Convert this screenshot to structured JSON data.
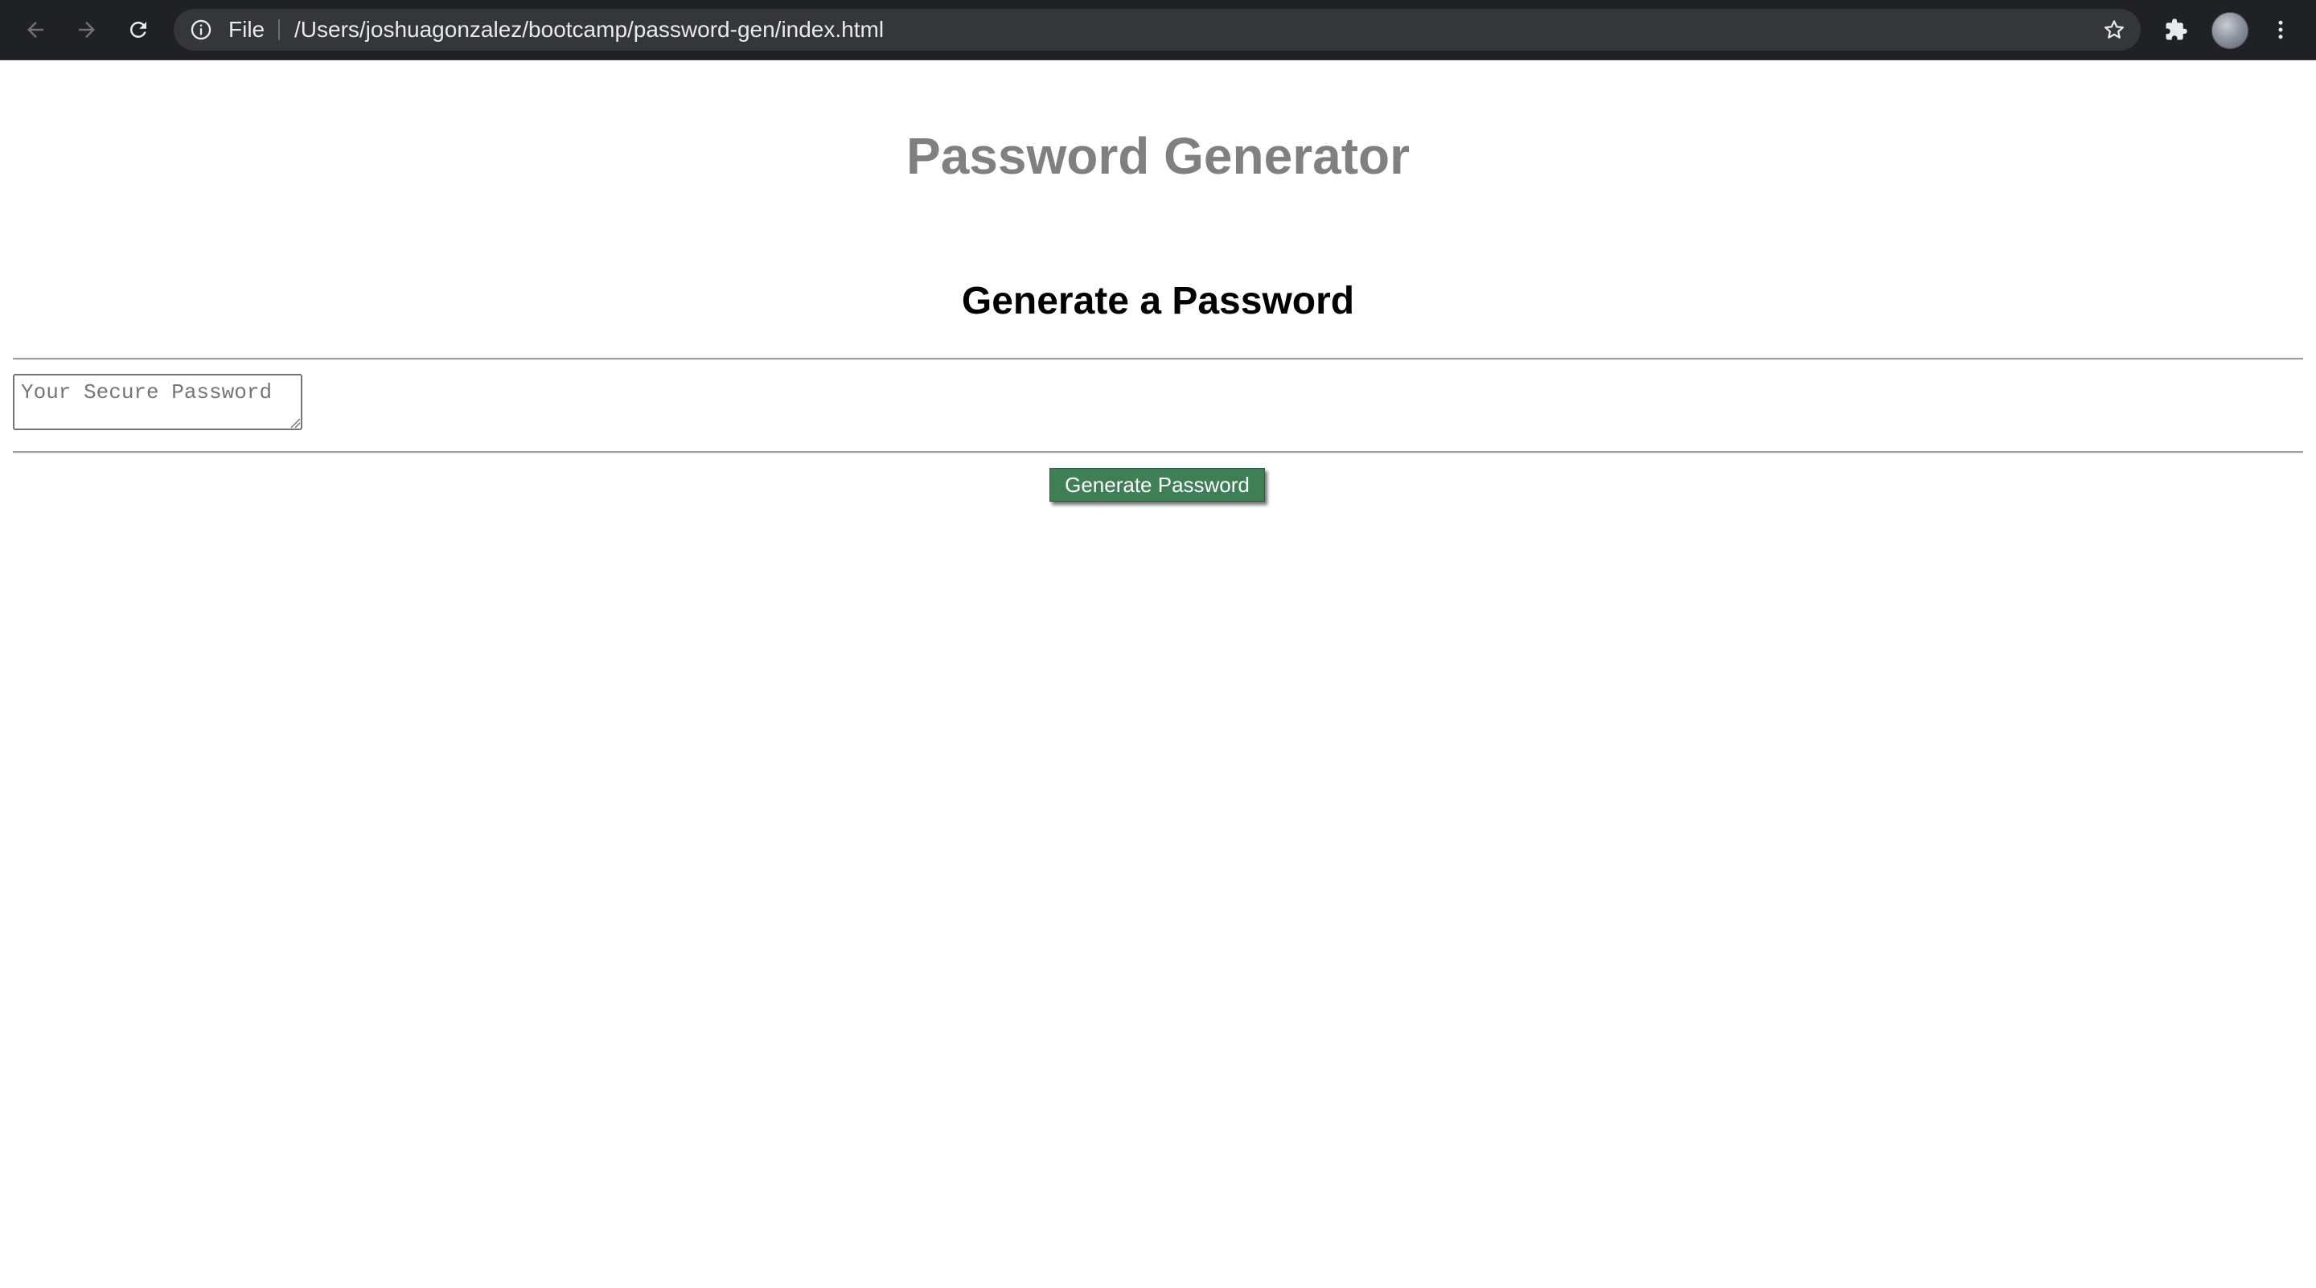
{
  "browser": {
    "file_label": "File",
    "url": "/Users/joshuagonzalez/bootcamp/password-gen/index.html",
    "icons": [
      "back-arrow-icon",
      "forward-arrow-icon",
      "reload-icon",
      "info-icon",
      "bookmark-star-icon",
      "extensions-puzzle-icon",
      "profile-avatar",
      "more-menu-icon"
    ]
  },
  "page": {
    "title": "Password Generator",
    "card_header": "Generate a Password",
    "password_placeholder": "Your Secure Password",
    "password_value": "",
    "generate_button_label": "Generate Password"
  },
  "colors": {
    "title_gray": "#808080",
    "button_green": "#3f7f55",
    "toolbar_dark": "#202124",
    "omnibox_dark": "#35363a"
  }
}
